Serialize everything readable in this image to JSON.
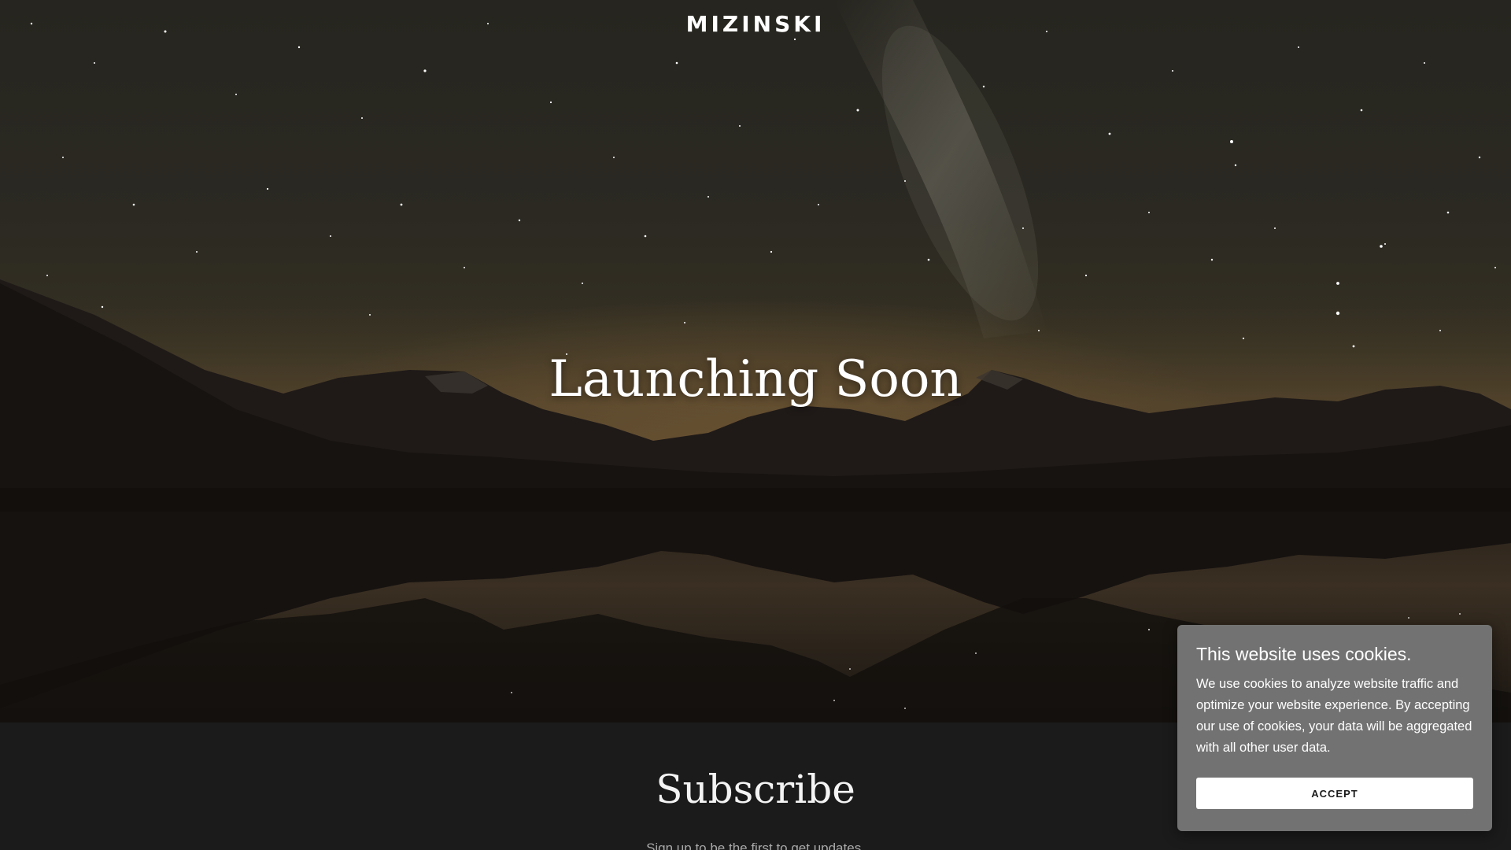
{
  "header": {
    "brand": "MIZINSKI"
  },
  "hero": {
    "title": "Launching Soon",
    "background": "starry-night-mountain-lake-image"
  },
  "subscribe": {
    "title": "Subscribe",
    "subtitle": "Sign up to be the first to get updates."
  },
  "cookie_banner": {
    "title": "This website uses cookies.",
    "body": "We use cookies to analyze website traffic and optimize your website experience. By accepting our use of cookies, your data will be aggregated with all other user data.",
    "accept_label": "ACCEPT"
  },
  "colors": {
    "page_background": "#1b1b1b",
    "cookie_background": "#727272",
    "button_background": "#ffffff",
    "text_primary": "#ffffff"
  }
}
